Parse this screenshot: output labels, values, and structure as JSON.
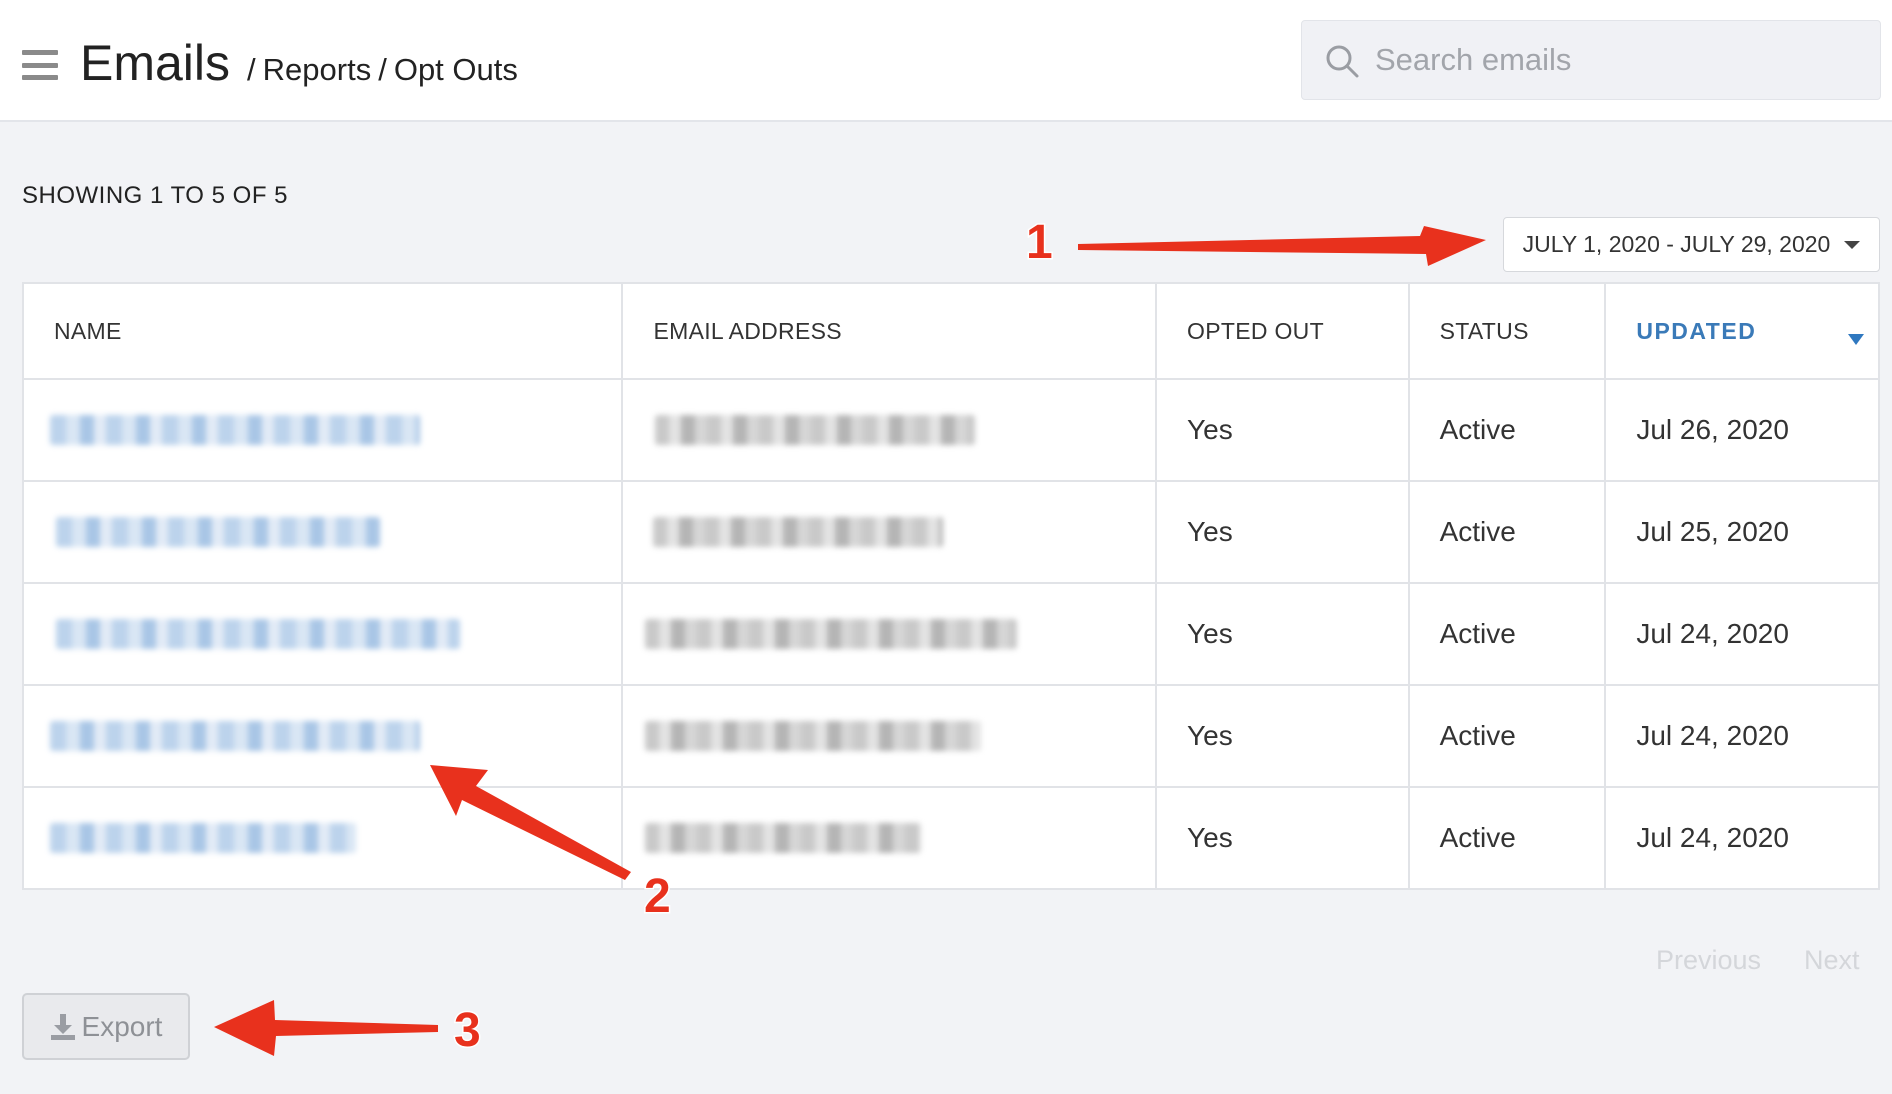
{
  "header": {
    "title": "Emails",
    "breadcrumbs": [
      "Reports",
      "Opt Outs"
    ],
    "separator": "/"
  },
  "search": {
    "placeholder": "Search emails",
    "value": ""
  },
  "summary": {
    "showing_text": "SHOWING 1 TO 5 OF 5"
  },
  "date_range": {
    "label": "JULY 1, 2020 - JULY 29, 2020"
  },
  "table": {
    "columns": [
      "NAME",
      "EMAIL ADDRESS",
      "OPTED OUT",
      "STATUS",
      "UPDATED"
    ],
    "sorted_column": "UPDATED",
    "rows": [
      {
        "opted_out": "Yes",
        "status": "Active",
        "updated": "Jul 26, 2020"
      },
      {
        "opted_out": "Yes",
        "status": "Active",
        "updated": "Jul 25, 2020"
      },
      {
        "opted_out": "Yes",
        "status": "Active",
        "updated": "Jul 24, 2020"
      },
      {
        "opted_out": "Yes",
        "status": "Active",
        "updated": "Jul 24, 2020"
      },
      {
        "opted_out": "Yes",
        "status": "Active",
        "updated": "Jul 24, 2020"
      }
    ]
  },
  "pagination": {
    "previous": "Previous",
    "next": "Next"
  },
  "export": {
    "label": "Export"
  },
  "annotations": {
    "labels": [
      "1",
      "2",
      "3"
    ],
    "color": "#e8311d"
  },
  "icons": {
    "menu": "hamburger-icon",
    "search": "search-icon",
    "dropdown": "caret-down-icon",
    "sort": "sort-desc-icon",
    "export": "download-icon"
  },
  "colors": {
    "accent": "#3a7ab8",
    "annotation": "#e8311d",
    "background": "#f2f3f6"
  }
}
